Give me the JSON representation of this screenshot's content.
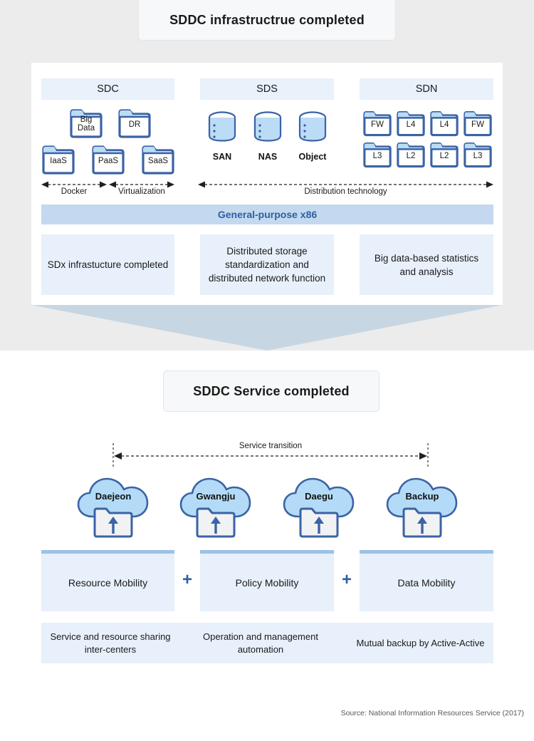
{
  "sections": {
    "top": {
      "title": "SDDC infrastructrue completed",
      "columns": [
        {
          "header": "SDC",
          "folders_row1": [
            {
              "label": "Big\nData",
              "line1": "Big",
              "line2": "Data"
            },
            {
              "label": "DR",
              "line1": "DR",
              "line2": ""
            }
          ],
          "folders_row2": [
            {
              "label": "IaaS"
            },
            {
              "label": "PaaS"
            },
            {
              "label": "SaaS"
            }
          ],
          "measures": [
            {
              "label": "Docker"
            },
            {
              "label": "Virtualization"
            }
          ]
        },
        {
          "header": "SDS",
          "cylinders": [
            {
              "label": "SAN"
            },
            {
              "label": "NAS"
            },
            {
              "label": "Object"
            }
          ],
          "measures": [
            {
              "label": "Distribution technology"
            }
          ]
        },
        {
          "header": "SDN",
          "folders_row1": [
            {
              "label": "FW"
            },
            {
              "label": "L4"
            },
            {
              "label": "L4"
            },
            {
              "label": "FW"
            }
          ],
          "folders_row2": [
            {
              "label": "L3"
            },
            {
              "label": "L2"
            },
            {
              "label": "L2"
            },
            {
              "label": "L3"
            }
          ]
        }
      ],
      "platform_bar": "General-purpose x86",
      "outcomes": [
        "SDx infrastucture completed",
        "Distributed storage standardization and distributed network function",
        "Big data-based statistics and analysis"
      ]
    },
    "bottom": {
      "title": "SDDC  Service completed",
      "transition_label": "Service transition",
      "clouds": [
        {
          "label": "Daejeon"
        },
        {
          "label": "Gwangju"
        },
        {
          "label": "Daegu"
        },
        {
          "label": "Backup"
        }
      ],
      "mobility": [
        "Resource Mobility",
        "Policy Mobility",
        "Data Mobility"
      ],
      "plus_symbol": "+",
      "benefits": [
        "Service and resource sharing inter-centers",
        "Operation and management automation",
        "Mutual backup by Active-Active"
      ]
    }
  },
  "source": "Source: National Information Resources Service (2017)",
  "colors": {
    "page_bg": "#ececec",
    "panel_bg": "#ffffff",
    "header_blue": "#e9f1fb",
    "bar_blue": "#c4d9ef",
    "box_blue": "#e8f0fb",
    "accent_blue": "#2e5fa3",
    "icon_outline": "#3b63a5",
    "icon_fill": "#bcdcf5",
    "arrow_fill": "#c7d6e3"
  }
}
